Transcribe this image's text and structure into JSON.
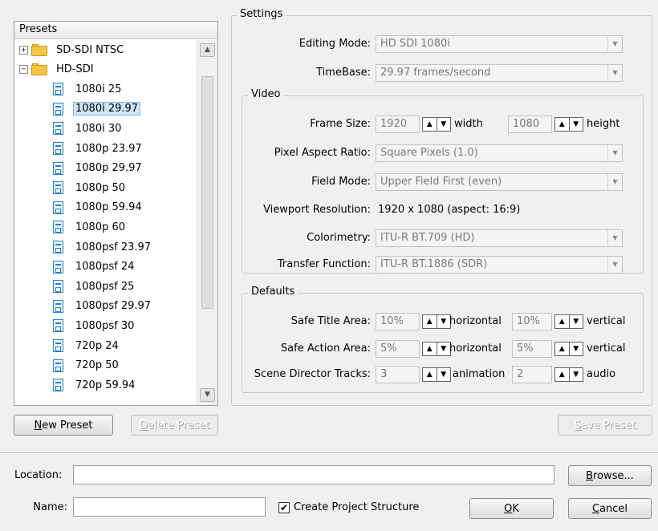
{
  "presets": {
    "header": "Presets",
    "items": [
      {
        "label": "SD-SDI NTSC",
        "kind": "folder",
        "expander": "+"
      },
      {
        "label": "HD-SDI",
        "kind": "folder",
        "expander": "−"
      },
      {
        "label": "1080i 25",
        "kind": "file"
      },
      {
        "label": "1080i 29.97",
        "kind": "file",
        "selected": true
      },
      {
        "label": "1080i 30",
        "kind": "file"
      },
      {
        "label": "1080p 23.97",
        "kind": "file"
      },
      {
        "label": "1080p 29.97",
        "kind": "file"
      },
      {
        "label": "1080p 50",
        "kind": "file"
      },
      {
        "label": "1080p 59.94",
        "kind": "file"
      },
      {
        "label": "1080p 60",
        "kind": "file"
      },
      {
        "label": "1080psf 23.97",
        "kind": "file"
      },
      {
        "label": "1080psf 24",
        "kind": "file"
      },
      {
        "label": "1080psf 25",
        "kind": "file"
      },
      {
        "label": "1080psf 29.97",
        "kind": "file"
      },
      {
        "label": "1080psf 30",
        "kind": "file"
      },
      {
        "label": "720p 24",
        "kind": "file"
      },
      {
        "label": "720p 50",
        "kind": "file"
      },
      {
        "label": "720p 59.94",
        "kind": "file"
      }
    ],
    "new_preset_label_u": "N",
    "new_preset_label_rest": "ew Preset",
    "delete_preset_label_u": "D",
    "delete_preset_label_rest": "elete Preset",
    "save_preset_label_u": "S",
    "save_preset_label_rest": "ave Preset"
  },
  "settings": {
    "title": "Settings",
    "editing_mode": {
      "label": "Editing Mode:",
      "value": "HD SDI 1080i"
    },
    "timebase": {
      "label": "TimeBase:",
      "value": "29.97 frames/second"
    }
  },
  "video": {
    "title": "Video",
    "frame_size": {
      "label": "Frame Size:",
      "width": "1920",
      "width_unit": "width",
      "height": "1080",
      "height_unit": "height"
    },
    "pixel_aspect": {
      "label": "Pixel Aspect Ratio:",
      "value": "Square Pixels (1.0)"
    },
    "field_mode": {
      "label": "Field Mode:",
      "value": "Upper Field First (even)"
    },
    "viewport": {
      "label": "Viewport Resolution:",
      "value": "1920 x 1080  (aspect: 16:9)"
    },
    "colorimetry": {
      "label": "Colorimetry:",
      "value": "ITU-R BT.709 (HD)"
    },
    "transfer": {
      "label": "Transfer Function:",
      "value": "ITU-R BT.1886 (SDR)"
    }
  },
  "defaults": {
    "title": "Defaults",
    "safe_title": {
      "label": "Safe Title Area:",
      "h": "10%",
      "h_unit": "horizontal",
      "v": "10%",
      "v_unit": "vertical"
    },
    "safe_action": {
      "label": "Safe Action Area:",
      "h": "5%",
      "h_unit": "horizontal",
      "v": "5%",
      "v_unit": "vertical"
    },
    "scene_tracks": {
      "label": "Scene Director Tracks:",
      "a": "3",
      "a_unit": "animation",
      "b": "2",
      "b_unit": "audio"
    }
  },
  "footer": {
    "location_label": "Location:",
    "location_value": "",
    "browse_u": "B",
    "browse_rest": "rowse...",
    "name_label": "Name:",
    "name_value": "",
    "create_structure_label": "Create Project Structure",
    "create_structure_checked": "✔",
    "ok_u": "O",
    "ok_rest": "K",
    "cancel_u": "C",
    "cancel_rest": "ancel"
  },
  "icons": {
    "folder": "folder-icon",
    "file": "preset-file-icon",
    "scroll_up": "▲",
    "scroll_down": "▼",
    "combo_arrow": "▼",
    "spin_up": "▲",
    "spin_down": "▼"
  }
}
